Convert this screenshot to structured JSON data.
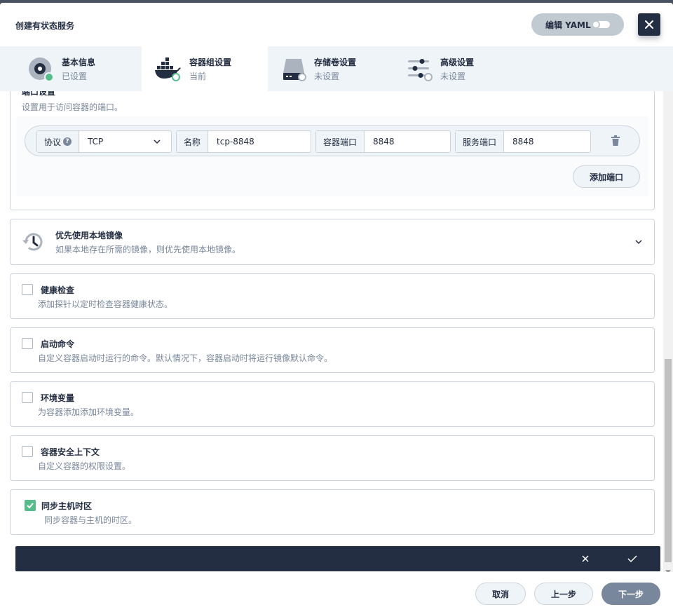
{
  "modal": {
    "title": "创建有状态服务",
    "yaml_label": "编辑 YAML"
  },
  "steps": [
    {
      "name": "基本信息",
      "status": "已设置"
    },
    {
      "name": "容器组设置",
      "status": "当前"
    },
    {
      "name": "存储卷设置",
      "status": "未设置"
    },
    {
      "name": "高级设置",
      "status": "未设置"
    }
  ],
  "ports": {
    "heading": "端口设置",
    "description": "设置用于访问容器的端口。",
    "protocol_label": "协议",
    "protocol_value": "TCP",
    "name_label": "名称",
    "name_value": "tcp-8848",
    "container_port_label": "容器端口",
    "container_port_value": "8848",
    "service_port_label": "服务端口",
    "service_port_value": "8848",
    "add_label": "添加端口"
  },
  "options": {
    "local_image": {
      "title": "优先使用本地镜像",
      "desc": "如果本地存在所需的镜像，则优先使用本地镜像。"
    },
    "health": {
      "title": "健康检查",
      "desc": "添加探针以定时检查容器健康状态。",
      "checked": false
    },
    "command": {
      "title": "启动命令",
      "desc": "自定义容器启动时运行的命令。默认情况下，容器启动时将运行镜像默认命令。",
      "checked": false
    },
    "env": {
      "title": "环境变量",
      "desc": "为容器添加添加环境变量。",
      "checked": false
    },
    "security": {
      "title": "容器安全上下文",
      "desc": "自定义容器的权限设置。",
      "checked": false
    },
    "timezone": {
      "title": "同步主机时区",
      "desc": "同步容器与主机的时区。",
      "checked": true
    }
  },
  "footer": {
    "cancel": "取消",
    "prev": "上一步",
    "next": "下一步"
  },
  "colors": {
    "primary_dark": "#242e42",
    "success": "#55bc8a",
    "muted": "#79879c",
    "border": "#ccd3db"
  }
}
